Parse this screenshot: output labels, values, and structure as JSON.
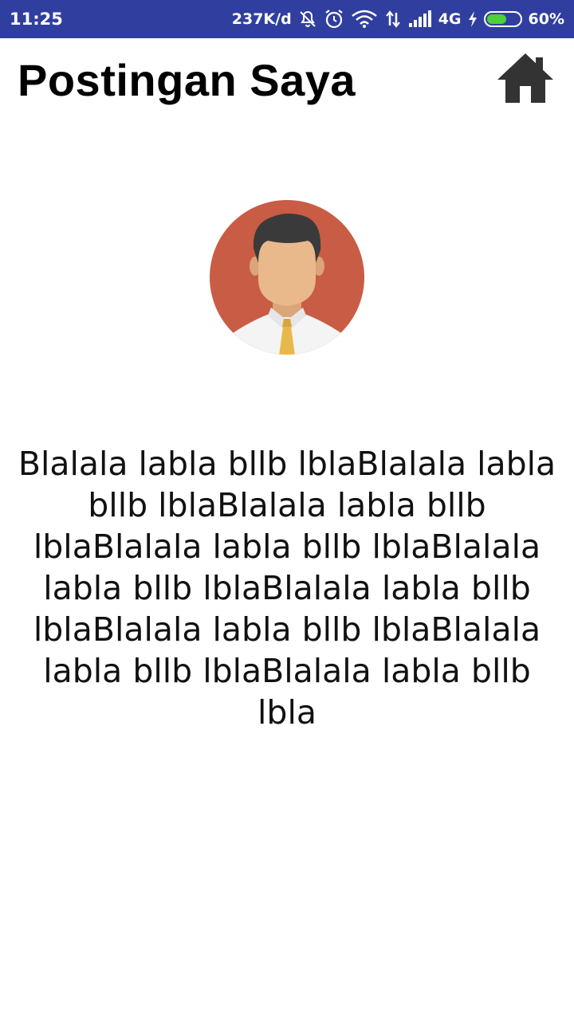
{
  "status_bar": {
    "time": "11:25",
    "network_speed": "237K/d",
    "network_type": "4G",
    "battery_percent": "60%",
    "battery_level": 0.6,
    "icons": [
      "mute-bell-icon",
      "alarm-icon",
      "wifi-icon",
      "data-transfer-icon",
      "signal-icon",
      "charging-icon",
      "battery-icon"
    ]
  },
  "header": {
    "title": "Postingan Saya",
    "home_icon": "home-icon"
  },
  "post": {
    "avatar_icon": "user-avatar",
    "text": "Blalala labla bllb lblaBlalala labla bllb lblaBlalala labla bllb lblaBlalala labla bllb lblaBlalala labla bllb lblaBlalala labla bllb lblaBlalala labla bllb lblaBlalala labla bllb lblaBlalala labla bllb lbla"
  },
  "colors": {
    "status_bar": "#303f9f",
    "home_icon": "#333333",
    "avatar_bg": "#c95c45",
    "tie": "#e8b84a"
  }
}
